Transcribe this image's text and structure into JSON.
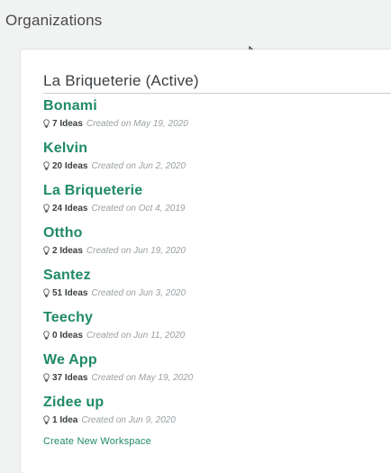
{
  "page": {
    "title": "Organizations"
  },
  "active_org": {
    "label": "La Briqueterie (Active)"
  },
  "organizations": [
    {
      "name": "Bonami",
      "ideas": "7 Ideas",
      "created": "Created on May 19, 2020"
    },
    {
      "name": "Kelvin",
      "ideas": "20 Ideas",
      "created": "Created on Jun 2, 2020"
    },
    {
      "name": "La Briqueterie",
      "ideas": "24 Ideas",
      "created": "Created on Oct 4, 2019"
    },
    {
      "name": "Ottho",
      "ideas": "2 Ideas",
      "created": "Created on Jun 19, 2020"
    },
    {
      "name": "Santez",
      "ideas": "51 Ideas",
      "created": "Created on Jun 3, 2020"
    },
    {
      "name": "Teechy",
      "ideas": "0 Ideas",
      "created": "Created on Jun 11, 2020"
    },
    {
      "name": "We App",
      "ideas": "37 Ideas",
      "created": "Created on May 19, 2020"
    },
    {
      "name": "Zidee up",
      "ideas": "1 Idea",
      "created": "Created on Jun 9, 2020"
    }
  ],
  "actions": {
    "create_workspace": "Create New Workspace"
  },
  "colors": {
    "accent": "#1f8a66",
    "background": "#f1f2f2",
    "muted": "#9aa0a4"
  },
  "icons": {
    "idea": "lightbulb-icon",
    "pointer": "mouse-cursor-icon"
  }
}
